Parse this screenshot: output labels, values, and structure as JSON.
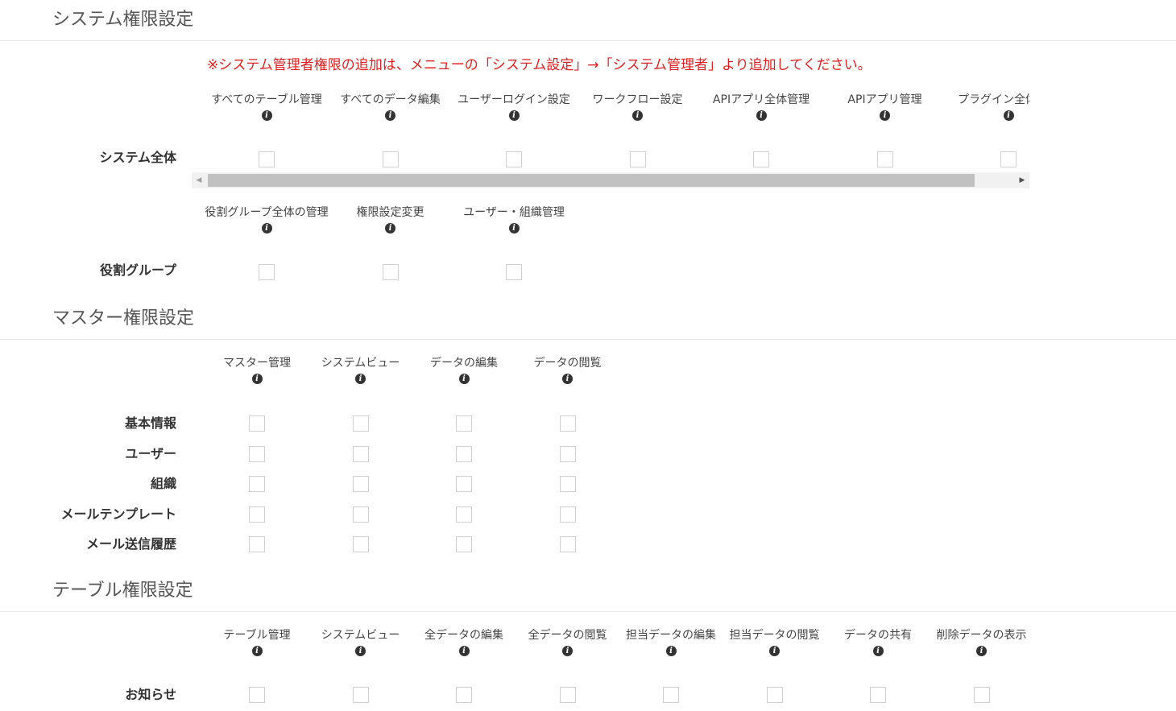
{
  "system": {
    "title": "システム権限設定",
    "notice": "※システム管理者権限の追加は、メニューの「システム設定」→「システム管理者」より追加してください。",
    "global": {
      "row_label": "システム全体",
      "columns": [
        "すべてのテーブル管理",
        "すべてのデータ編集",
        "ユーザーログイン設定",
        "ワークフロー設定",
        "APIアプリ全体管理",
        "APIアプリ管理",
        "プラグイン全体管理"
      ]
    },
    "role": {
      "row_label": "役割グループ",
      "columns": [
        "役割グループ全体の管理",
        "権限設定変更",
        "ユーザー・組織管理"
      ]
    }
  },
  "master": {
    "title": "マスター権限設定",
    "columns": [
      "マスター管理",
      "システムビュー",
      "データの編集",
      "データの閲覧"
    ],
    "rows": [
      "基本情報",
      "ユーザー",
      "組織",
      "メールテンプレート",
      "メール送信履歴"
    ]
  },
  "table": {
    "title": "テーブル権限設定",
    "columns": [
      "テーブル管理",
      "システムビュー",
      "全データの編集",
      "全データの閲覧",
      "担当データの編集",
      "担当データの閲覧",
      "データの共有",
      "削除データの表示"
    ],
    "rows": [
      "お知らせ"
    ]
  },
  "icons": {
    "info": "info-circle-icon",
    "scroll_left": "arrow-left-icon",
    "scroll_right": "arrow-right-icon"
  },
  "colors": {
    "notice": "#e02020",
    "checkbox_border": "#d0d0d0"
  }
}
